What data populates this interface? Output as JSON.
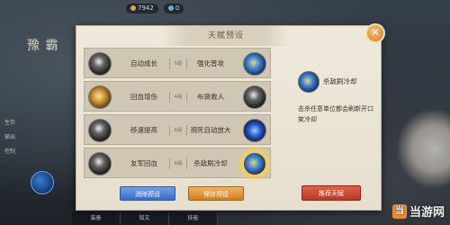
{
  "topbar": {
    "resource1": "7942",
    "resource2": "0"
  },
  "left": {
    "title": "豫 霸",
    "tabs": [
      "生存",
      "输出",
      "控制"
    ],
    "bottom_tabs": [
      "装备",
      "铭文",
      "技能"
    ]
  },
  "panel": {
    "title": "天赋预设",
    "talents": [
      {
        "left": "自动成长",
        "level": "6级",
        "right": "强化普攻"
      },
      {
        "left": "回血增伤",
        "level": "4级",
        "right": "布袋救人"
      },
      {
        "left": "移速提高",
        "level": "6级",
        "right": "濒死自动放大"
      },
      {
        "left": "友军回血",
        "level": "8级",
        "right": "杀敌刷冷却"
      }
    ],
    "selected": {
      "name": "杀敌刷冷却",
      "description": "击杀任意单位都会刷新开口笑冷却"
    },
    "buttons": {
      "clear": "消除预设",
      "save": "保存预设",
      "recommend": "推荐天赋"
    }
  },
  "icons": {
    "close": "close-icon",
    "talent": "talent-icon"
  },
  "watermark": {
    "text": "当游网",
    "logo": "当"
  }
}
